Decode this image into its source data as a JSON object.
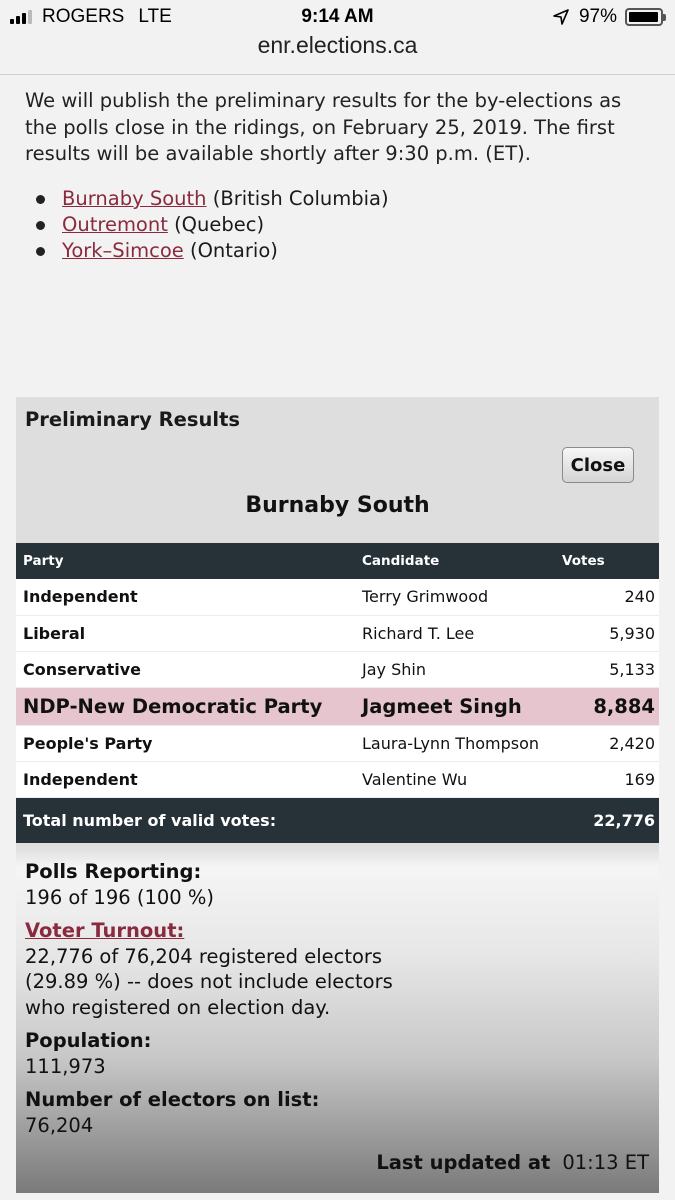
{
  "status": {
    "carrier": "ROGERS",
    "network": "LTE",
    "time": "9:14 AM",
    "battery": "97%",
    "battery_level": 0.97
  },
  "browser": {
    "url": "enr.elections.ca"
  },
  "intro": {
    "text": "We will publish the preliminary results for the by-elections as the polls close in the ridings, on February 25, 2019. The first results will be available shortly after 9:30 p.m. (ET).",
    "ridings": [
      {
        "name": "Burnaby South",
        "province": "(British Columbia)"
      },
      {
        "name": "Outremont",
        "province": "(Quebec)"
      },
      {
        "name": "York–Simcoe",
        "province": "(Ontario)"
      }
    ]
  },
  "results": {
    "title": "Preliminary Results",
    "close_label": "Close",
    "riding": "Burnaby South",
    "columns": {
      "party": "Party",
      "candidate": "Candidate",
      "votes": "Votes"
    },
    "rows": [
      {
        "party": "Independent",
        "candidate": "Terry Grimwood",
        "votes": "240"
      },
      {
        "party": "Liberal",
        "candidate": "Richard T. Lee",
        "votes": "5,930"
      },
      {
        "party": "Conservative",
        "candidate": "Jay Shin",
        "votes": "5,133"
      },
      {
        "party": "NDP-New Democratic Party",
        "candidate": "Jagmeet Singh",
        "votes": "8,884"
      },
      {
        "party": "People's Party",
        "candidate": "Laura-Lynn Thompson",
        "votes": "2,420"
      },
      {
        "party": "Independent",
        "candidate": "Valentine Wu",
        "votes": "169"
      }
    ],
    "total_label": "Total number of valid votes:",
    "total_value": "22,776",
    "polls_label": "Polls Reporting:",
    "polls_value": "196 of 196 (100 %)",
    "turnout_label": "Voter Turnout:",
    "turnout_line1": "22,776 of 76,204 registered electors",
    "turnout_line2": "(29.89 %) -- does not include electors",
    "turnout_line3": "who registered on election day.",
    "population_label": "Population:",
    "population_value": "111,973",
    "electors_label": "Number of electors on list:",
    "electors_value": "76,204",
    "updated_label": "Last updated at",
    "updated_value": "01:13 ET"
  }
}
